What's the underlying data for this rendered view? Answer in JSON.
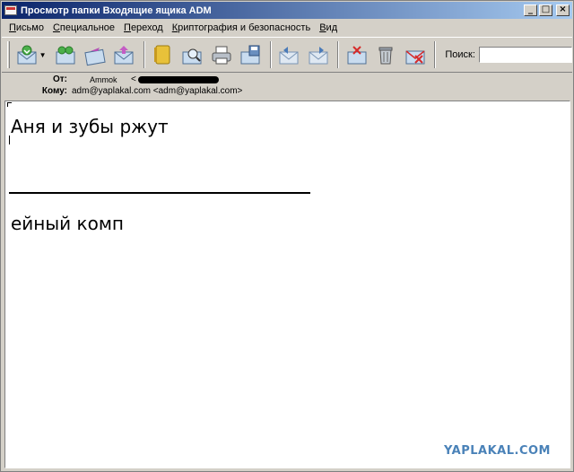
{
  "window": {
    "title": "Просмотр папки Входящие ящика ADM",
    "minimize": "_",
    "maximize": "□",
    "close": "×"
  },
  "menu": {
    "items": [
      {
        "label": "Письмо"
      },
      {
        "label": "Специальное"
      },
      {
        "label": "Переход"
      },
      {
        "label": "Криптография и безопасность"
      },
      {
        "label": "Вид"
      }
    ]
  },
  "toolbar": {
    "dropdown_glyph": "▼",
    "search_label": "Поиск:",
    "search_value": ""
  },
  "header": {
    "from_label": "От:",
    "from_name": "Ammok",
    "from_address_prefix": "<",
    "to_label": "Кому:",
    "to_value": "adm@yaplakal.com <adm@yaplakal.com>"
  },
  "message": {
    "line1": "Аня и зубы ржут",
    "line2": "ейный комп"
  },
  "watermark": "YAPLAKAL.COM",
  "colors": {
    "titlebar_start": "#0a246a",
    "titlebar_end": "#a6caf0",
    "chrome": "#d4d0c8",
    "watermark": "#4a82b8"
  }
}
